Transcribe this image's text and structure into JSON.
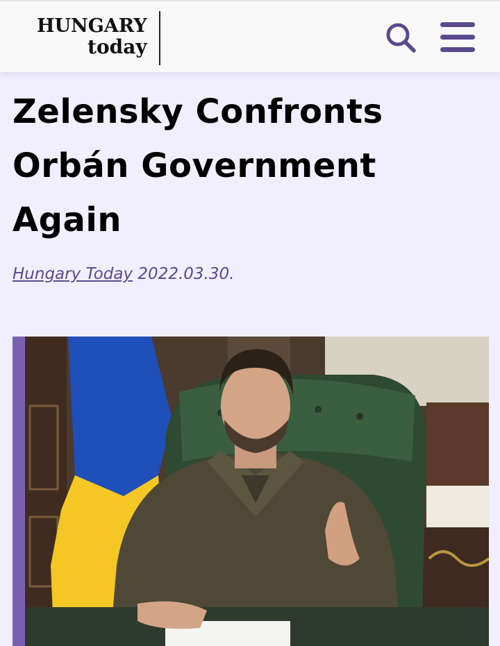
{
  "header": {
    "logo_line1": "HUNGARY",
    "logo_line2": "today",
    "search_icon": "search-icon",
    "menu_icon": "hamburger-menu-icon",
    "accent_color": "#5a4a8c"
  },
  "article": {
    "title": "Zelensky Confronts Orbán Government Again",
    "author": "Hungary Today",
    "date": "2022.03.30."
  },
  "hero_image": {
    "flag_colors": [
      "#1f4fb8",
      "#f4c724"
    ]
  }
}
